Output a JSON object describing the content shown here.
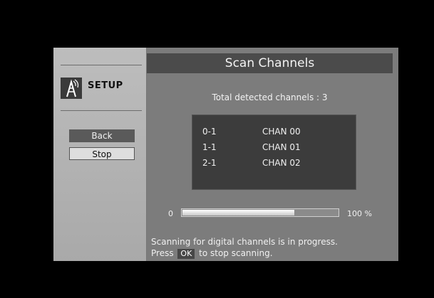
{
  "sidebar": {
    "app_label": "SETUP",
    "menu": [
      {
        "label": "Back",
        "selected": true
      },
      {
        "label": "Stop",
        "selected": false
      }
    ]
  },
  "main": {
    "title": "Scan Channels",
    "total_text": "Total detected channels : 3",
    "channels": [
      {
        "number": "0-1",
        "name": "CHAN 00"
      },
      {
        "number": "1-1",
        "name": "CHAN 01"
      },
      {
        "number": "2-1",
        "name": "CHAN 02"
      }
    ],
    "progress": {
      "start_label": "0",
      "end_label": "100 %",
      "fill_fraction": 0.72
    },
    "status_line1": "Scanning for digital channels is in progress.",
    "status_line2_prefix": "Press",
    "status_key": "OK",
    "status_line2_suffix": "to stop scanning."
  },
  "colors": {
    "title_bar": "#4b4b4b",
    "selected_button": "#5a5a5a"
  },
  "icons": {
    "logo": "antenna-tower-icon"
  }
}
